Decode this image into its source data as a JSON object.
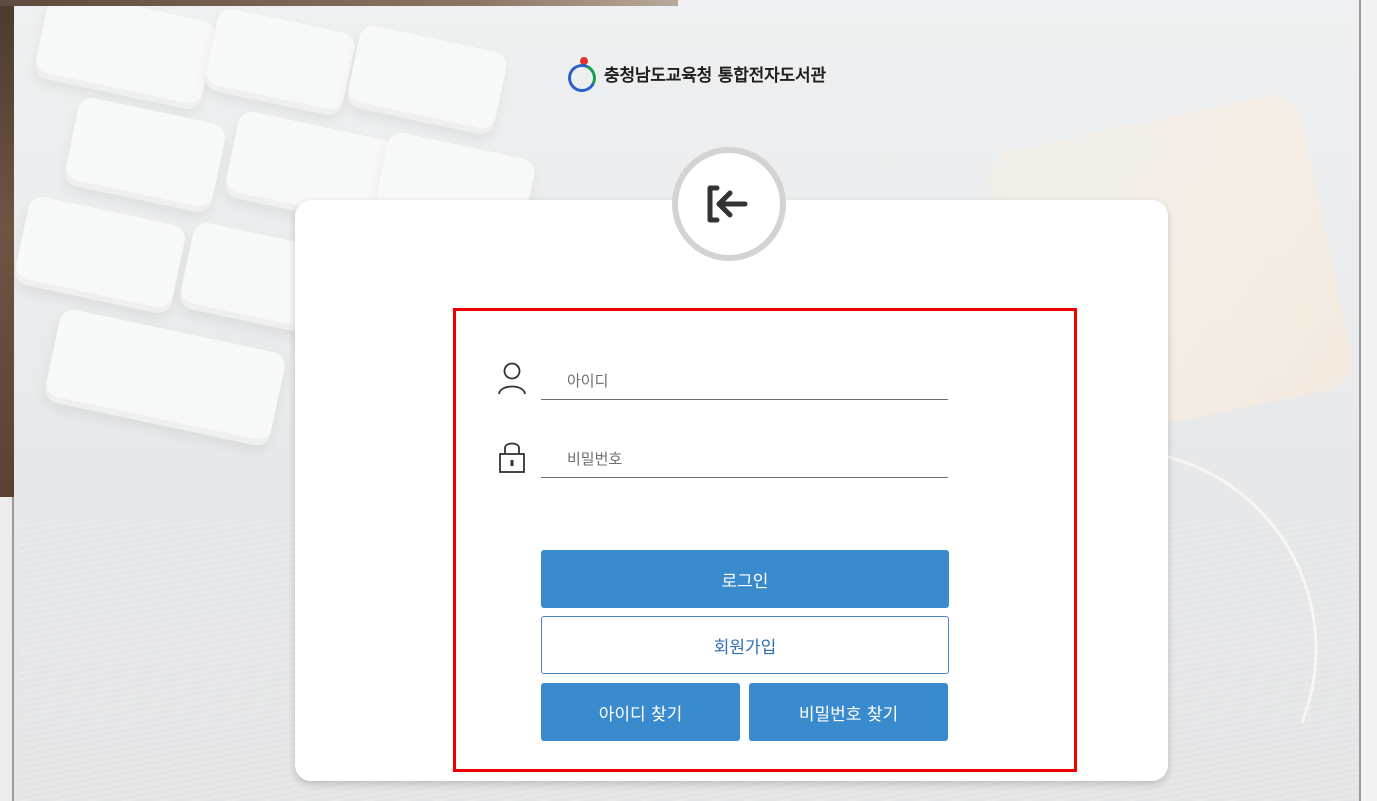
{
  "header": {
    "title": "충청남도교육청 통합전자도서관"
  },
  "login_icon": "login-arrow-icon",
  "login_form": {
    "username": {
      "placeholder": "아이디",
      "value": "",
      "icon": "user-icon"
    },
    "password": {
      "placeholder": "비밀번호",
      "value": "",
      "icon": "lock-icon"
    },
    "buttons": {
      "login": "로그인",
      "signup": "회원가입",
      "find_id": "아이디 찾기",
      "find_password": "비밀번호 찾기"
    }
  },
  "colors": {
    "primary": "#3a8bce",
    "highlight_border": "#ee0000"
  }
}
